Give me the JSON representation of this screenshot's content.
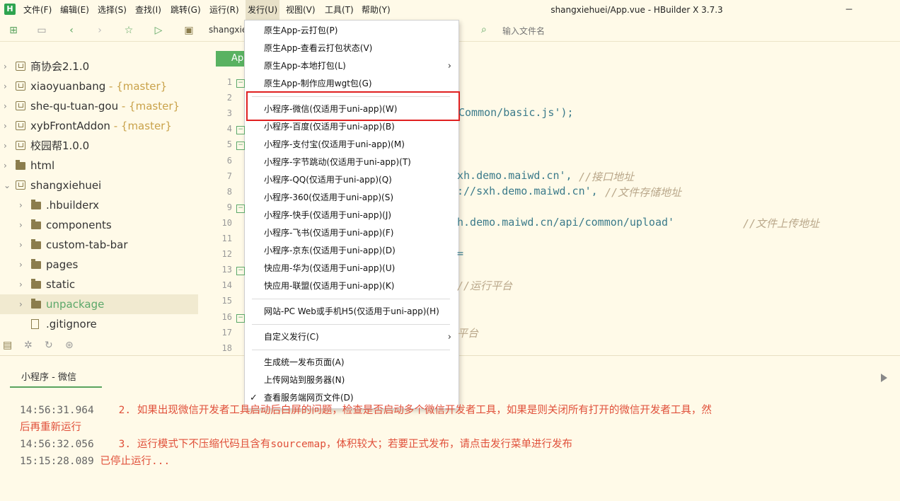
{
  "menubar": {
    "logo": "H",
    "items": [
      "文件(F)",
      "编辑(E)",
      "选择(S)",
      "查找(I)",
      "跳转(G)",
      "运行(R)",
      "发行(U)",
      "视图(V)",
      "工具(T)",
      "帮助(Y)"
    ],
    "active_index": 6,
    "window_title": "shangxiehuei/App.vue - HBuilder X 3.7.3",
    "controls": [
      "minimize-icon",
      "maximize-icon",
      "close-icon"
    ]
  },
  "toolbar": {
    "icons": [
      "new-file-icon",
      "save-icon",
      "back-icon",
      "forward-icon",
      "star-icon",
      "run-icon"
    ],
    "breadcrumb": "shangxie",
    "search_placeholder": "输入文件名"
  },
  "sidebar": {
    "items": [
      {
        "name": "商协会2.1.0",
        "branch": "",
        "level": 0,
        "type": "project",
        "expanded": false
      },
      {
        "name": "xiaoyuanbang",
        "branch": " - {master}",
        "level": 0,
        "type": "project",
        "expanded": false
      },
      {
        "name": "she-qu-tuan-gou",
        "branch": " - {master}",
        "level": 0,
        "type": "project",
        "expanded": false
      },
      {
        "name": "xybFrontAddon",
        "branch": " - {master}",
        "level": 0,
        "type": "project",
        "expanded": false
      },
      {
        "name": "校园帮1.0.0",
        "branch": "",
        "level": 0,
        "type": "project",
        "expanded": false
      },
      {
        "name": "html",
        "branch": "",
        "level": 0,
        "type": "folder",
        "expanded": false
      },
      {
        "name": "shangxiehuei",
        "branch": "",
        "level": 0,
        "type": "project",
        "expanded": true
      },
      {
        "name": ".hbuilderx",
        "branch": "",
        "level": 1,
        "type": "folder",
        "expanded": false
      },
      {
        "name": "components",
        "branch": "",
        "level": 1,
        "type": "folder",
        "expanded": false
      },
      {
        "name": "custom-tab-bar",
        "branch": "",
        "level": 1,
        "type": "folder",
        "expanded": false
      },
      {
        "name": "pages",
        "branch": "",
        "level": 1,
        "type": "folder",
        "expanded": false
      },
      {
        "name": "static",
        "branch": "",
        "level": 1,
        "type": "folder",
        "expanded": false
      },
      {
        "name": "unpackage",
        "branch": "",
        "level": 1,
        "type": "folder",
        "expanded": false,
        "selected": true
      },
      {
        "name": ".gitignore",
        "branch": "",
        "level": 1,
        "type": "file",
        "expanded": false
      }
    ],
    "tools": [
      "explorer-icon",
      "bug-icon",
      "refresh-icon",
      "plugin-icon"
    ]
  },
  "editor": {
    "tab_label": "App",
    "line_numbers": [
      "1",
      "2",
      "3",
      "4",
      "5",
      "6",
      "7",
      "8",
      "9",
      "10",
      "11",
      "12",
      "13",
      "14",
      "15",
      "16",
      "17",
      "18"
    ],
    "fold_lines": [
      1,
      4,
      5,
      9,
      13,
      16
    ],
    "code_fragments": [
      {
        "line": 3,
        "text": "Common/basic.js');",
        "kind": "code"
      },
      {
        "line": 7,
        "text": "xh.demo.maiwd.cn', ",
        "kind": "code"
      },
      {
        "line": 7,
        "text": "//接口地址",
        "kind": "comment"
      },
      {
        "line": 8,
        "text": "://sxh.demo.maiwd.cn', ",
        "kind": "code"
      },
      {
        "line": 8,
        "text": "//文件存储地址",
        "kind": "comment"
      },
      {
        "line": 10,
        "text": "h.demo.maiwd.cn/api/common/upload'",
        "kind": "code"
      },
      {
        "line": 10,
        "text": "//文件上传地址",
        "kind": "comment"
      },
      {
        "line": 12,
        "text": "=",
        "kind": "code"
      },
      {
        "line": 14,
        "text": "//运行平台",
        "kind": "comment"
      },
      {
        "line": 17,
        "text": "平台",
        "kind": "comment"
      }
    ]
  },
  "console": {
    "tab_label": "小程序 - 微信",
    "logs": [
      {
        "ts": "14:56:31.964",
        "msg": "    2. 如果出现微信开发者工具启动后白屏的问题，检查是否启动多个微信开发者工具，如果是则关闭所有打开的微信开发者工具，然"
      },
      {
        "ts": "",
        "msg": "后再重新运行"
      },
      {
        "ts": "14:56:32.056",
        "msg": "    3. 运行模式下不压缩代码且含有sourcemap，体积较大；若要正式发布，请点击发行菜单进行发布"
      },
      {
        "ts": "15:15:28.089",
        "msg": " 已停止运行..."
      }
    ]
  },
  "dropdown": {
    "items": [
      {
        "label": "原生App-云打包(P)",
        "submenu": false
      },
      {
        "label": "原生App-查看云打包状态(V)",
        "submenu": false
      },
      {
        "label": "原生App-本地打包(L)",
        "submenu": true
      },
      {
        "label": "原生App-制作应用wgt包(G)",
        "submenu": false
      },
      {
        "label": "---"
      },
      {
        "label": "小程序-微信(仅适用于uni-app)(W)",
        "submenu": false,
        "highlighted": true
      },
      {
        "label": "小程序-百度(仅适用于uni-app)(B)",
        "submenu": false
      },
      {
        "label": "小程序-支付宝(仅适用于uni-app)(M)",
        "submenu": false
      },
      {
        "label": "小程序-字节跳动(仅适用于uni-app)(T)",
        "submenu": false
      },
      {
        "label": "小程序-QQ(仅适用于uni-app)(Q)",
        "submenu": false
      },
      {
        "label": "小程序-360(仅适用于uni-app)(S)",
        "submenu": false
      },
      {
        "label": "小程序-快手(仅适用于uni-app)(J)",
        "submenu": false
      },
      {
        "label": "小程序-飞书(仅适用于uni-app)(F)",
        "submenu": false
      },
      {
        "label": "小程序-京东(仅适用于uni-app)(D)",
        "submenu": false
      },
      {
        "label": "快应用-华为(仅适用于uni-app)(U)",
        "submenu": false
      },
      {
        "label": "快应用-联盟(仅适用于uni-app)(K)",
        "submenu": false
      },
      {
        "label": "---"
      },
      {
        "label": "网站-PC Web或手机H5(仅适用于uni-app)(H)",
        "submenu": false
      },
      {
        "label": "---"
      },
      {
        "label": "自定义发行(C)",
        "submenu": true
      },
      {
        "label": "---"
      },
      {
        "label": "生成统一发布页面(A)",
        "submenu": false
      },
      {
        "label": "上传网站到服务器(N)",
        "submenu": false
      },
      {
        "label": "查看服务端网页文件(D)",
        "submenu": false,
        "checked": true
      }
    ]
  },
  "colors": {
    "background": "#fffae8",
    "accent_green": "#59b261",
    "highlight_red": "#e02020",
    "error_text": "#e0503a",
    "branch_text": "#c9a24a"
  }
}
